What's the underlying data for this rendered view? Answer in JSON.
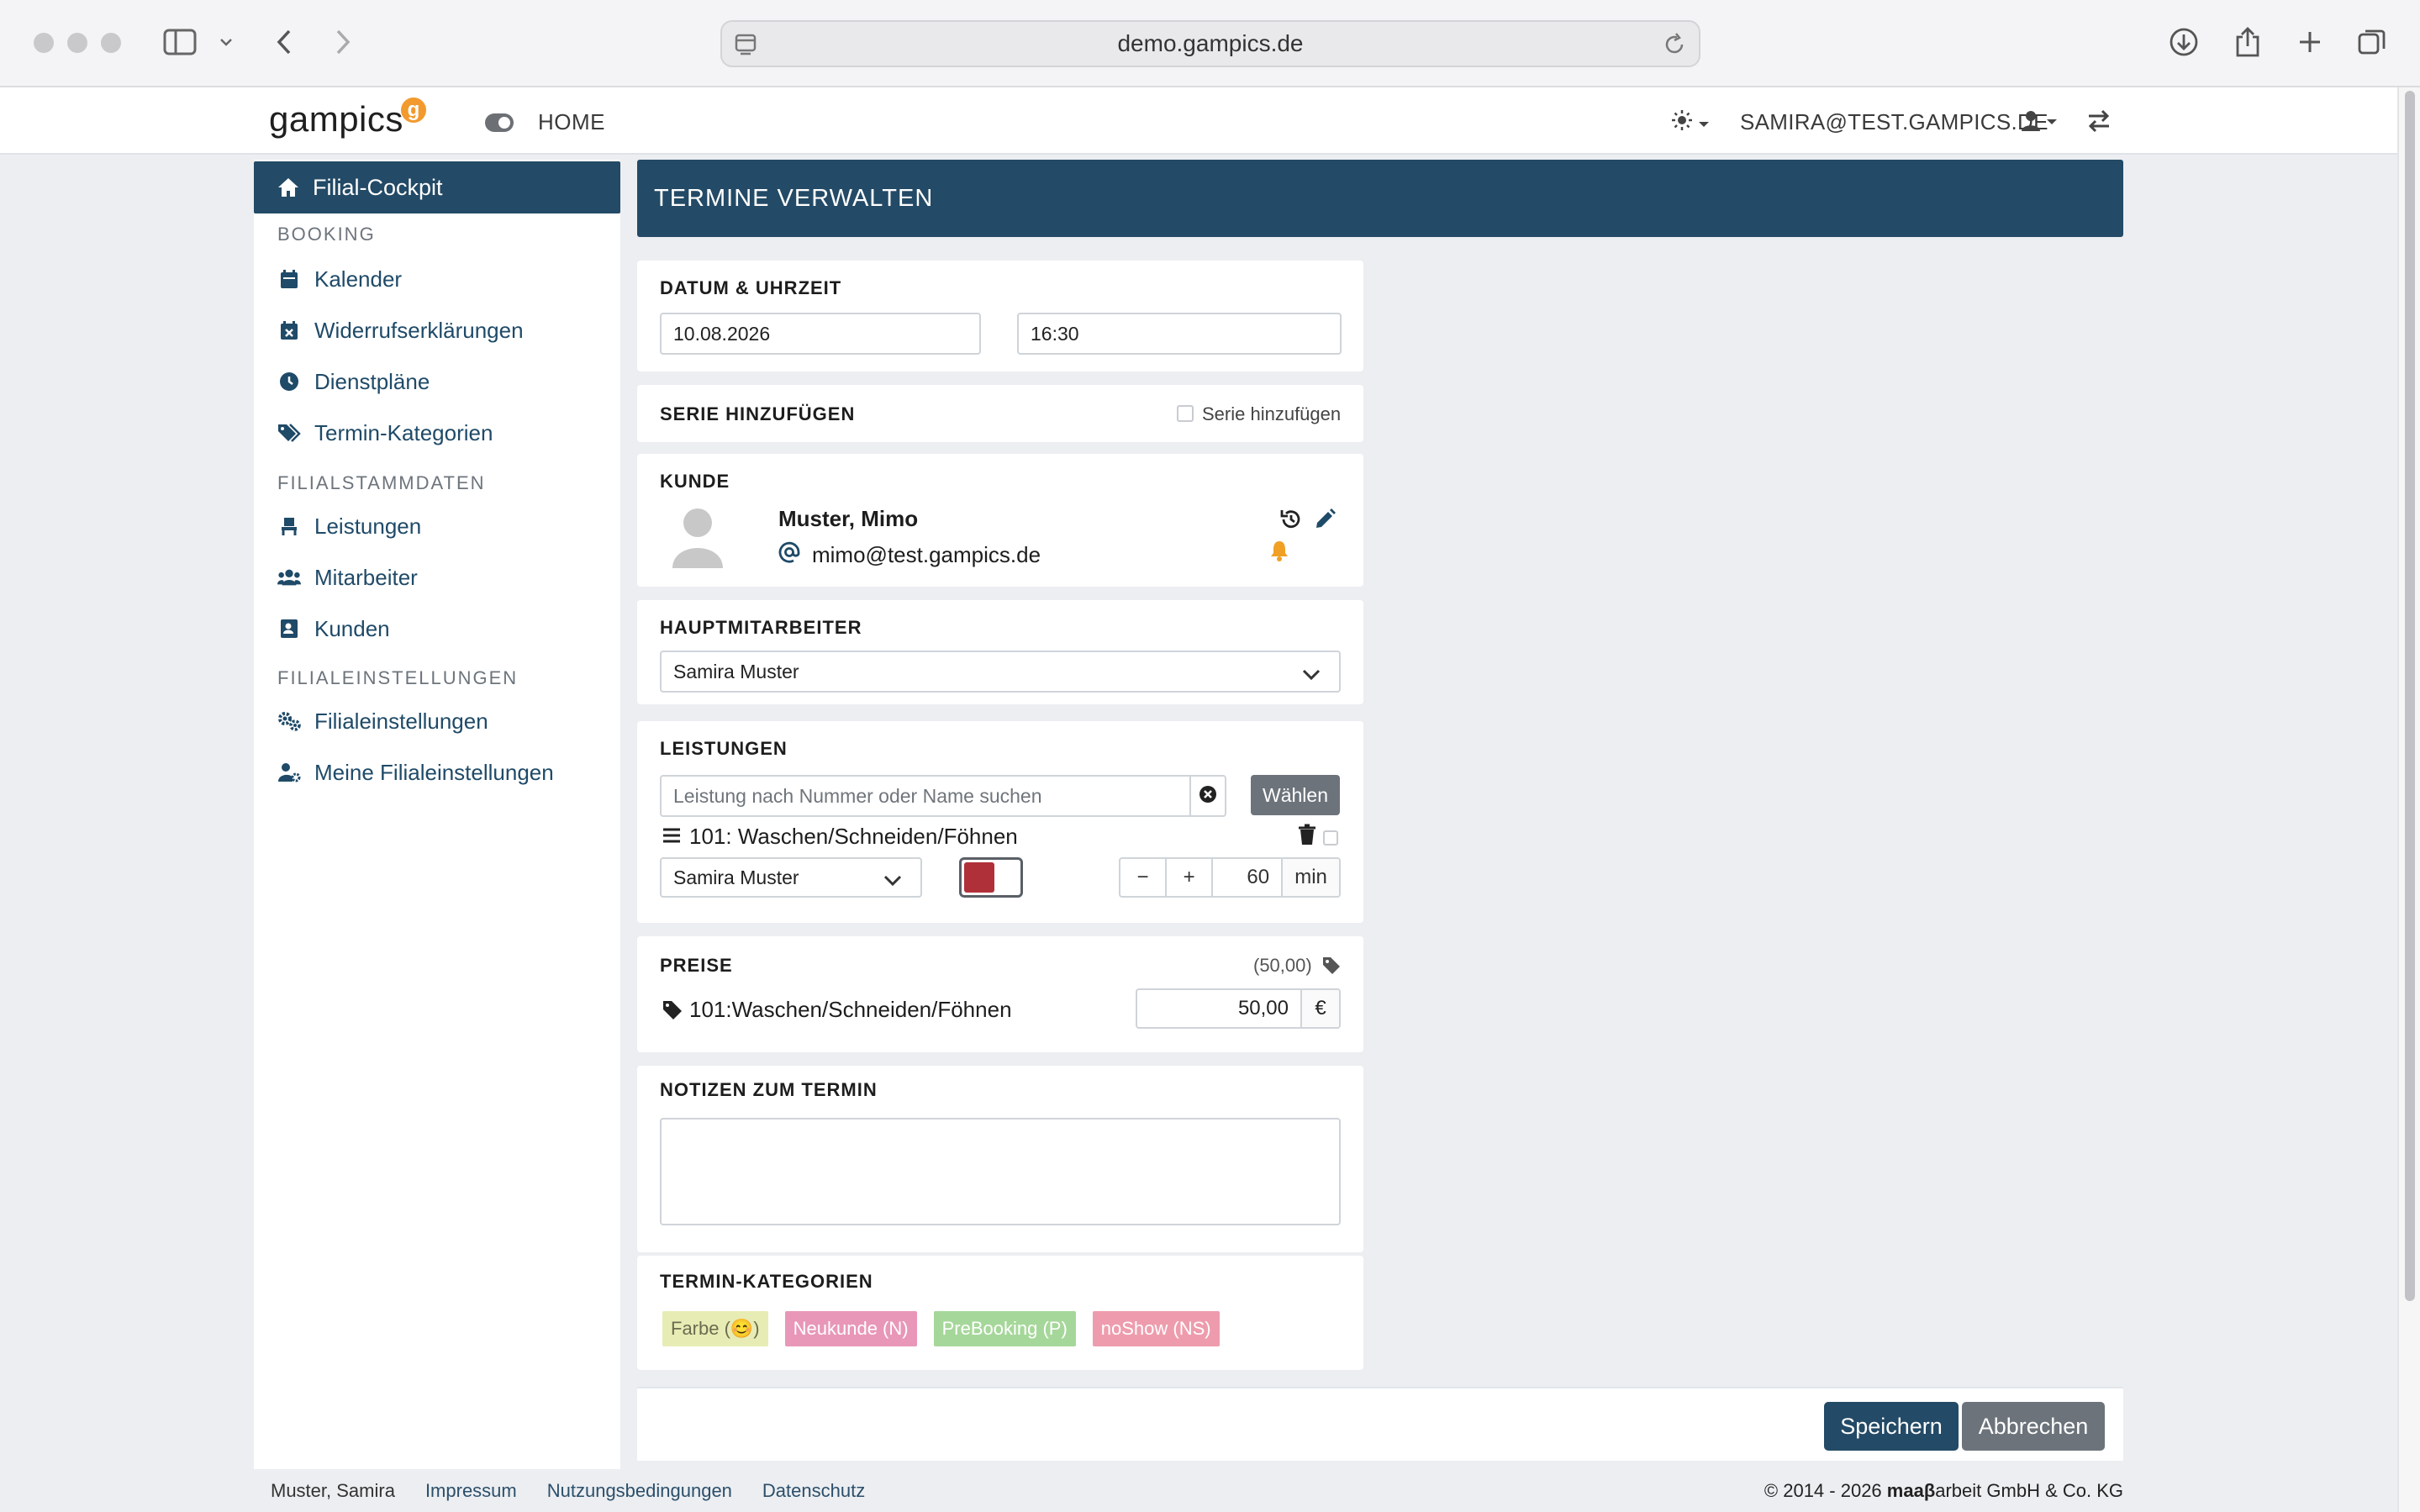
{
  "browser": {
    "url": "demo.gampics.de"
  },
  "header": {
    "logo": "gampics",
    "logo_badge": "g",
    "home": "HOME",
    "user_email": "SAMIRA@TEST.GAMPICS.DE"
  },
  "sidebar": {
    "active": "Filial-Cockpit",
    "section_booking": "BOOKING",
    "booking_items": [
      "Kalender",
      "Widerrufserklärungen",
      "Dienstpläne",
      "Termin-Kategorien"
    ],
    "section_stammdaten": "FILIALSTAMMDATEN",
    "stammdaten_items": [
      "Leistungen",
      "Mitarbeiter",
      "Kunden"
    ],
    "section_einstellungen": "FILIALEINSTELLUNGEN",
    "einstellungen_items": [
      "Filialeinstellungen",
      "Meine Filialeinstellungen"
    ]
  },
  "page": {
    "title": "TERMINE VERWALTEN"
  },
  "datetime": {
    "heading": "DATUM & UHRZEIT",
    "date": "10.08.2026",
    "time": "16:30"
  },
  "series": {
    "heading": "SERIE HINZUFÜGEN",
    "checkbox_label": "Serie hinzufügen",
    "checked": false
  },
  "customer": {
    "heading": "KUNDE",
    "name": "Muster, Mimo",
    "email": "mimo@test.gampics.de"
  },
  "main_staff": {
    "heading": "HAUPTMITARBEITER",
    "selected": "Samira Muster"
  },
  "services": {
    "heading": "LEISTUNGEN",
    "search_placeholder": "Leistung nach Nummer oder Name suchen",
    "choose_button": "Wählen",
    "item_name": "101: Waschen/Schneiden/Föhnen",
    "item_staff": "Samira Muster",
    "duration": "60",
    "duration_unit": "min",
    "minus": "−",
    "plus": "+"
  },
  "prices": {
    "heading": "PREISE",
    "total": "(50,00)",
    "item_name": "101:Waschen/Schneiden/Föhnen",
    "value": "50,00",
    "currency": "€"
  },
  "notes": {
    "heading": "NOTIZEN ZUM TERMIN",
    "value": ""
  },
  "categories": {
    "heading": "TERMIN-KATEGORIEN",
    "tags": [
      {
        "label": "Farbe (😊)",
        "color": "#e7ecb4",
        "text": "#6b6b50"
      },
      {
        "label": "Neukunde (N)",
        "color": "#e897b8",
        "text": "#ffffff"
      },
      {
        "label": "PreBooking (P)",
        "color": "#a6d79a",
        "text": "#ffffff"
      },
      {
        "label": "noShow (NS)",
        "color": "#ee9cad",
        "text": "#ffffff"
      }
    ]
  },
  "actions": {
    "save": "Speichern",
    "cancel": "Abbrechen"
  },
  "footer": {
    "user": "Muster, Samira",
    "links": [
      "Impressum",
      "Nutzungsbedingungen",
      "Datenschutz"
    ],
    "copyright_prefix": "© 2014 - 2026 ",
    "copyright_bold": "maaβ",
    "copyright_suffix": "arbeit GmbH & Co. KG"
  },
  "colors": {
    "primary": "#234a66",
    "secondary_button": "#6c737b",
    "bell": "#f0a024",
    "service_color": "#b0303a"
  }
}
